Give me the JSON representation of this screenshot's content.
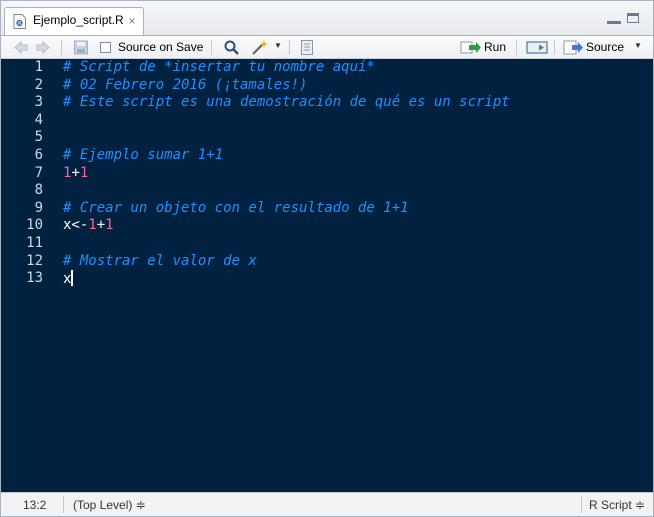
{
  "tab": {
    "title": "Ejemplo_script.R"
  },
  "toolbar": {
    "source_on_save_label": "Source on Save",
    "run_label": "Run",
    "source_label": "Source"
  },
  "editor": {
    "line_numbers": [
      "1",
      "2",
      "3",
      "4",
      "5",
      "6",
      "7",
      "8",
      "9",
      "10",
      "11",
      "12",
      "13"
    ],
    "lines": [
      [
        {
          "t": "comment",
          "v": "# Script de *insertar tu nombre aquí*"
        }
      ],
      [
        {
          "t": "comment",
          "v": "# 02 Febrero 2016 (¡tamales!)"
        }
      ],
      [
        {
          "t": "comment",
          "v": "# Este script es una demostración de qué es un script"
        }
      ],
      [],
      [],
      [
        {
          "t": "comment",
          "v": "# Ejemplo sumar 1+1"
        }
      ],
      [
        {
          "t": "num",
          "v": "1"
        },
        {
          "t": "plain",
          "v": "+"
        },
        {
          "t": "num",
          "v": "1"
        }
      ],
      [],
      [
        {
          "t": "comment",
          "v": "# Crear un objeto con el resultado de 1+1"
        }
      ],
      [
        {
          "t": "plain",
          "v": "x<-"
        },
        {
          "t": "num",
          "v": "1"
        },
        {
          "t": "plain",
          "v": "+"
        },
        {
          "t": "num",
          "v": "1"
        }
      ],
      [],
      [
        {
          "t": "comment",
          "v": "# Mostrar el valor de x"
        }
      ],
      [
        {
          "t": "plain",
          "v": "x"
        }
      ]
    ]
  },
  "status": {
    "position": "13:2",
    "scope": "(Top Level) ≑",
    "file_type": "R Script ≑"
  },
  "colors": {
    "editor_bg": "#002240",
    "comment": "#1e90ff",
    "number": "#ff5f9e",
    "text": "#ffffff"
  }
}
